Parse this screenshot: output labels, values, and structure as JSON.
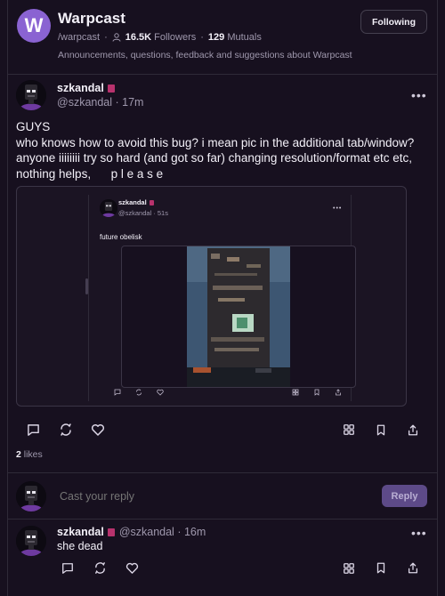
{
  "channel": {
    "logo_letter": "W",
    "name": "Warpcast",
    "handle": "/warpcast",
    "followers_count": "16.5K",
    "followers_label": "Followers",
    "mutuals_count": "129",
    "mutuals_label": "Mutuals",
    "description": "Announcements, questions, feedback and suggestions about Warpcast",
    "follow_button": "Following"
  },
  "cast": {
    "author": "szkandal",
    "handle": "@szkandal",
    "time": "17m",
    "text": "GUYS\nwho knows how to avoid this bug? i mean pic in the additional tab/window?  anyone iiiiiiii try so hard (and got so far) changing resolution/format etc etc, nothing helps,      p l e a s e",
    "likes_count": "2",
    "likes_label": "likes",
    "quote": {
      "author": "szkandal",
      "handle": "@szkandal",
      "time": "51s",
      "text": "future obelisk"
    }
  },
  "reply_box": {
    "placeholder": "Cast your reply",
    "button": "Reply"
  },
  "reply": {
    "author": "szkandal",
    "handle": "@szkandal",
    "time": "16m",
    "text": "she dead"
  },
  "colors": {
    "background": "#17101f",
    "accent": "#8a63d2",
    "badge": "#b8326d"
  }
}
